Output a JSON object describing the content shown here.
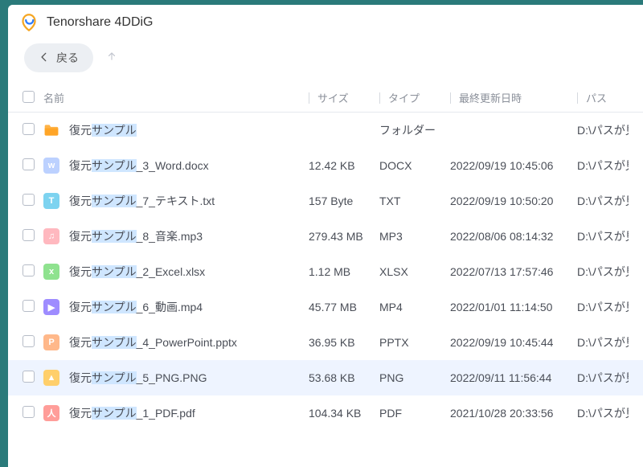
{
  "app": {
    "title": "Tenorshare 4DDiG"
  },
  "toolbar": {
    "back_label": "戻る"
  },
  "columns": {
    "name": "名前",
    "size": "サイズ",
    "type": "タイプ",
    "modified": "最終更新日時",
    "path": "パス"
  },
  "search_highlight": "サンプル",
  "icons": {
    "folder": {
      "glyph": "",
      "bg": "#ffb347"
    },
    "docx": {
      "glyph": "w",
      "bg": "#bcd1ff"
    },
    "txt": {
      "glyph": "T",
      "bg": "#7dd3f0"
    },
    "mp3": {
      "glyph": "♫",
      "bg": "#ffb8bf"
    },
    "xlsx": {
      "glyph": "x",
      "bg": "#8fe28f"
    },
    "mp4": {
      "glyph": "▶",
      "bg": "#9e8cff"
    },
    "pptx": {
      "glyph": "P",
      "bg": "#ffb88a"
    },
    "png": {
      "glyph": "▲",
      "bg": "#ffcf6b"
    },
    "pdf": {
      "glyph": "人",
      "bg": "#ff9d99"
    }
  },
  "rows": [
    {
      "icon": "folder",
      "name": "復元サンプル",
      "size": "",
      "type": "フォルダー",
      "date": "",
      "path": "D:\\パスが見",
      "is_folder": true
    },
    {
      "icon": "docx",
      "name": "復元サンプル_3_Word.docx",
      "size": "12.42 KB",
      "type": "DOCX",
      "date": "2022/09/19 10:45:06",
      "path": "D:\\パスが見"
    },
    {
      "icon": "txt",
      "name": "復元サンプル_7_テキスト.txt",
      "size": "157 Byte",
      "type": "TXT",
      "date": "2022/09/19 10:50:20",
      "path": "D:\\パスが見"
    },
    {
      "icon": "mp3",
      "name": "復元サンプル_8_音楽.mp3",
      "size": "279.43 MB",
      "type": "MP3",
      "date": "2022/08/06 08:14:32",
      "path": "D:\\パスが見"
    },
    {
      "icon": "xlsx",
      "name": "復元サンプル_2_Excel.xlsx",
      "size": "1.12 MB",
      "type": "XLSX",
      "date": "2022/07/13 17:57:46",
      "path": "D:\\パスが見"
    },
    {
      "icon": "mp4",
      "name": "復元サンプル_6_動画.mp4",
      "size": "45.77 MB",
      "type": "MP4",
      "date": "2022/01/01 11:14:50",
      "path": "D:\\パスが見"
    },
    {
      "icon": "pptx",
      "name": "復元サンプル_4_PowerPoint.pptx",
      "size": "36.95 KB",
      "type": "PPTX",
      "date": "2022/09/19 10:45:44",
      "path": "D:\\パスが見"
    },
    {
      "icon": "png",
      "name": "復元サンプル_5_PNG.PNG",
      "size": "53.68 KB",
      "type": "PNG",
      "date": "2022/09/11 11:56:44",
      "path": "D:\\パスが見",
      "selected": true
    },
    {
      "icon": "pdf",
      "name": "復元サンプル_1_PDF.pdf",
      "size": "104.34 KB",
      "type": "PDF",
      "date": "2021/10/28 20:33:56",
      "path": "D:\\パスが見"
    }
  ]
}
